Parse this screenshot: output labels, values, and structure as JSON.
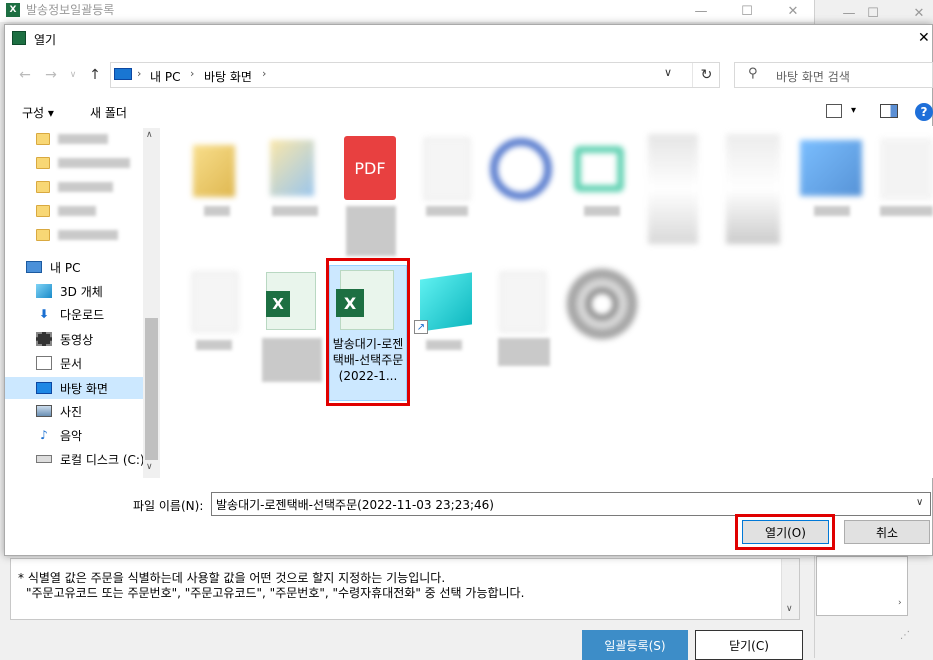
{
  "background_window": {
    "title": "발송정보일괄등록",
    "minimize": "—",
    "maximize": "☐",
    "close": "✕",
    "note_line1": "* 식별열 값은 주문을 식별하는데 사용할 값을 어떤 것으로 할지 지정하는 기능입니다.",
    "note_line2": "\"주문고유코드 또는 주문번호\", \"주문고유코드\", \"주문번호\", \"수령자휴대전화\" 중 선택 가능합니다.",
    "bulk_register_label": "일괄등록(S)",
    "close_label": "닫기(C)"
  },
  "dialog": {
    "title": "열기",
    "close": "✕",
    "breadcrumb": [
      "내 PC",
      "바탕 화면"
    ],
    "search_placeholder": "바탕 화면 검색",
    "toolbar": {
      "organize": "구성 ▾",
      "new_folder": "새 폴더",
      "help": "?"
    },
    "sidebar": {
      "this_pc": "내 PC",
      "items": [
        "3D 개체",
        "다운로드",
        "동영상",
        "문서",
        "바탕 화면",
        "사진",
        "음악",
        "로컬 디스크 (C:)"
      ]
    },
    "selected_file": {
      "label": "발송대기-로젠택배-선택주문 (2022-1..."
    },
    "filename_label": "파일 이름(N):",
    "filename_value": "발송대기-로젠택배-선택주문(2022-11-03 23;23;46)",
    "open_label": "열기(O)",
    "cancel_label": "취소"
  }
}
